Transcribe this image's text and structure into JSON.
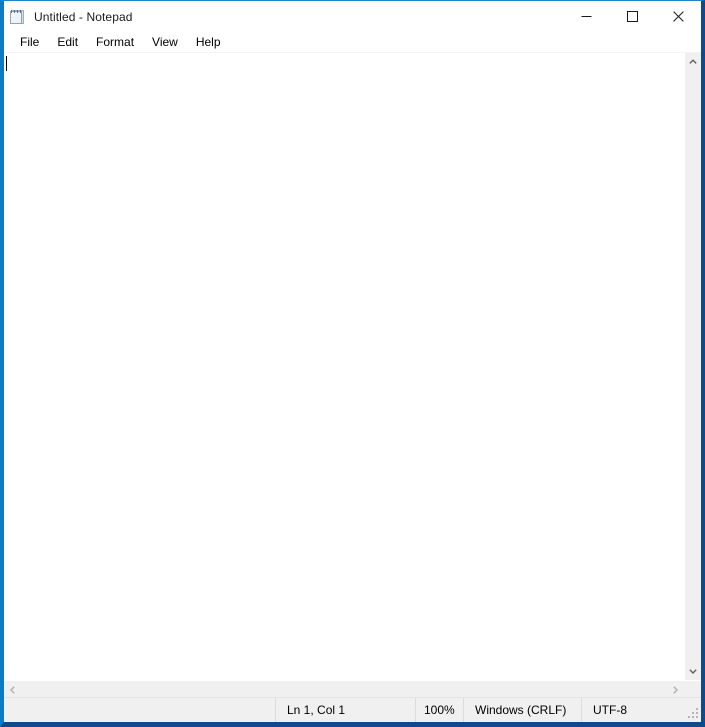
{
  "window": {
    "title": "Untitled - Notepad",
    "icon": "notepad-icon",
    "accent_color": "#0d7ac4",
    "border_color": "#0d4b8c",
    "controls": [
      {
        "name": "minimize",
        "glyph": "minimize-icon",
        "label": "Minimize"
      },
      {
        "name": "maximize",
        "glyph": "maximize-icon",
        "label": "Maximize"
      },
      {
        "name": "close",
        "glyph": "close-icon",
        "label": "Close"
      }
    ]
  },
  "menubar": {
    "items": [
      {
        "label": "File"
      },
      {
        "label": "Edit"
      },
      {
        "label": "Format"
      },
      {
        "label": "View"
      },
      {
        "label": "Help"
      }
    ]
  },
  "editor": {
    "content": "",
    "placeholder": "",
    "caret_visible": true,
    "background": "#ffffff"
  },
  "scrollbars": {
    "vertical": {
      "up_icon": "chevron-up-icon",
      "down_icon": "chevron-down-icon",
      "thumb_visible": false
    },
    "horizontal": {
      "left_icon": "chevron-left-icon",
      "right_icon": "chevron-right-icon",
      "thumb_visible": false
    }
  },
  "statusbar": {
    "line_col": "Ln 1, Col 1",
    "zoom": "100%",
    "line_ending": "Windows (CRLF)",
    "encoding": "UTF-8",
    "grip": "resize-grip-icon"
  }
}
